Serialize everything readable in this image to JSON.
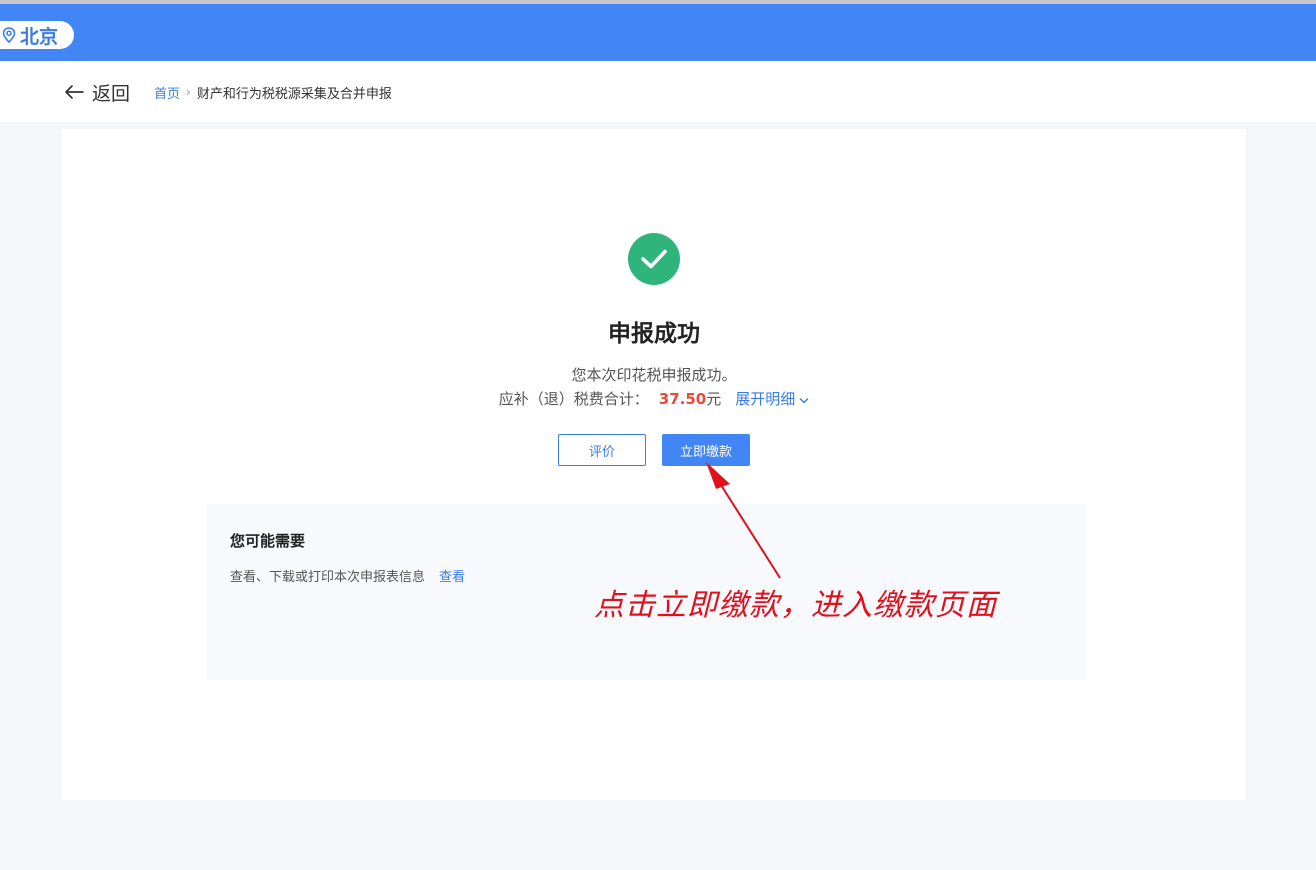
{
  "header": {
    "city": "北京",
    "city_icon": "location-pin-icon",
    "brand_color": "#4285f4"
  },
  "nav": {
    "back_label": "返回",
    "breadcrumb": {
      "home": "首页",
      "separator": "›",
      "current": "财产和行为税税源采集及合并申报"
    }
  },
  "result": {
    "status_icon": "check-circle-icon",
    "title": "申报成功",
    "message": "您本次印花税申报成功。",
    "amount_label": "应补（退）税费合计：",
    "amount_value": "37.50",
    "amount_unit": "元",
    "expand_label": "展开明细",
    "amount_color": "#e84b3c",
    "success_color": "#2fb57c"
  },
  "actions": {
    "rate_label": "评价",
    "pay_label": "立即缴款"
  },
  "suggestions": {
    "title": "您可能需要",
    "items": [
      {
        "text": "查看、下载或打印本次申报表信息",
        "link": "查看"
      }
    ]
  },
  "annotation": {
    "text": "点击立即缴款，进入缴款页面",
    "color": "#e0101c"
  }
}
